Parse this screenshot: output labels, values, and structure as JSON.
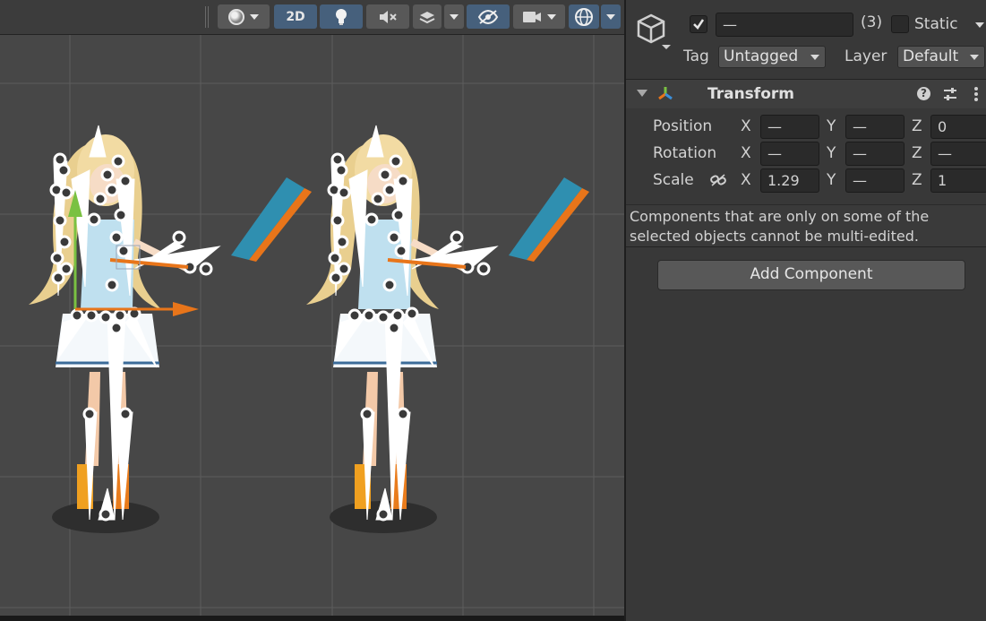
{
  "scene": {
    "toolbar": {
      "shading_icon": "shading-sphere-icon",
      "mode_2d_label": "2D",
      "lighting_icon": "lightbulb-icon",
      "audio_icon": "audio-mute-icon",
      "effects_icon": "layers-effects-icon",
      "visibility_icon": "eye-hidden-icon",
      "camera_icon": "camera-icon",
      "gizmos_icon": "gizmo-globe-icon"
    }
  },
  "inspector": {
    "header": {
      "object_icon": "gameobject-cube-icon",
      "active_checked": true,
      "name_value": "—",
      "selection_count": "(3)",
      "static_label": "Static",
      "tag_label": "Tag",
      "tag_value": "Untagged",
      "layer_label": "Layer",
      "layer_value": "Default"
    },
    "transform": {
      "title": "Transform",
      "help_icon": "help-icon",
      "presets_icon": "presets-sliders-icon",
      "menu_icon": "more-vertical-icon",
      "position": {
        "label": "Position",
        "x_label": "X",
        "x": "—",
        "y_label": "Y",
        "y": "—",
        "z_label": "Z",
        "z": "0"
      },
      "rotation": {
        "label": "Rotation",
        "x_label": "X",
        "x": "—",
        "y_label": "Y",
        "y": "—",
        "z_label": "Z",
        "z": "—"
      },
      "scale": {
        "label": "Scale",
        "link_icon": "unlinked-chain-icon",
        "x_label": "X",
        "x": "1.29",
        "y_label": "Y",
        "y": "—",
        "z_label": "Z",
        "z": "1"
      }
    },
    "notice_line1": "Components that are only on some of the",
    "notice_line2": "selected objects cannot be multi-edited.",
    "add_component_label": "Add Component"
  },
  "colors": {
    "accent_active": "#46607c",
    "gizmo_orange": "#e8751a",
    "gizmo_green": "#7ac142",
    "prop_blue": "#2f8fb0"
  }
}
